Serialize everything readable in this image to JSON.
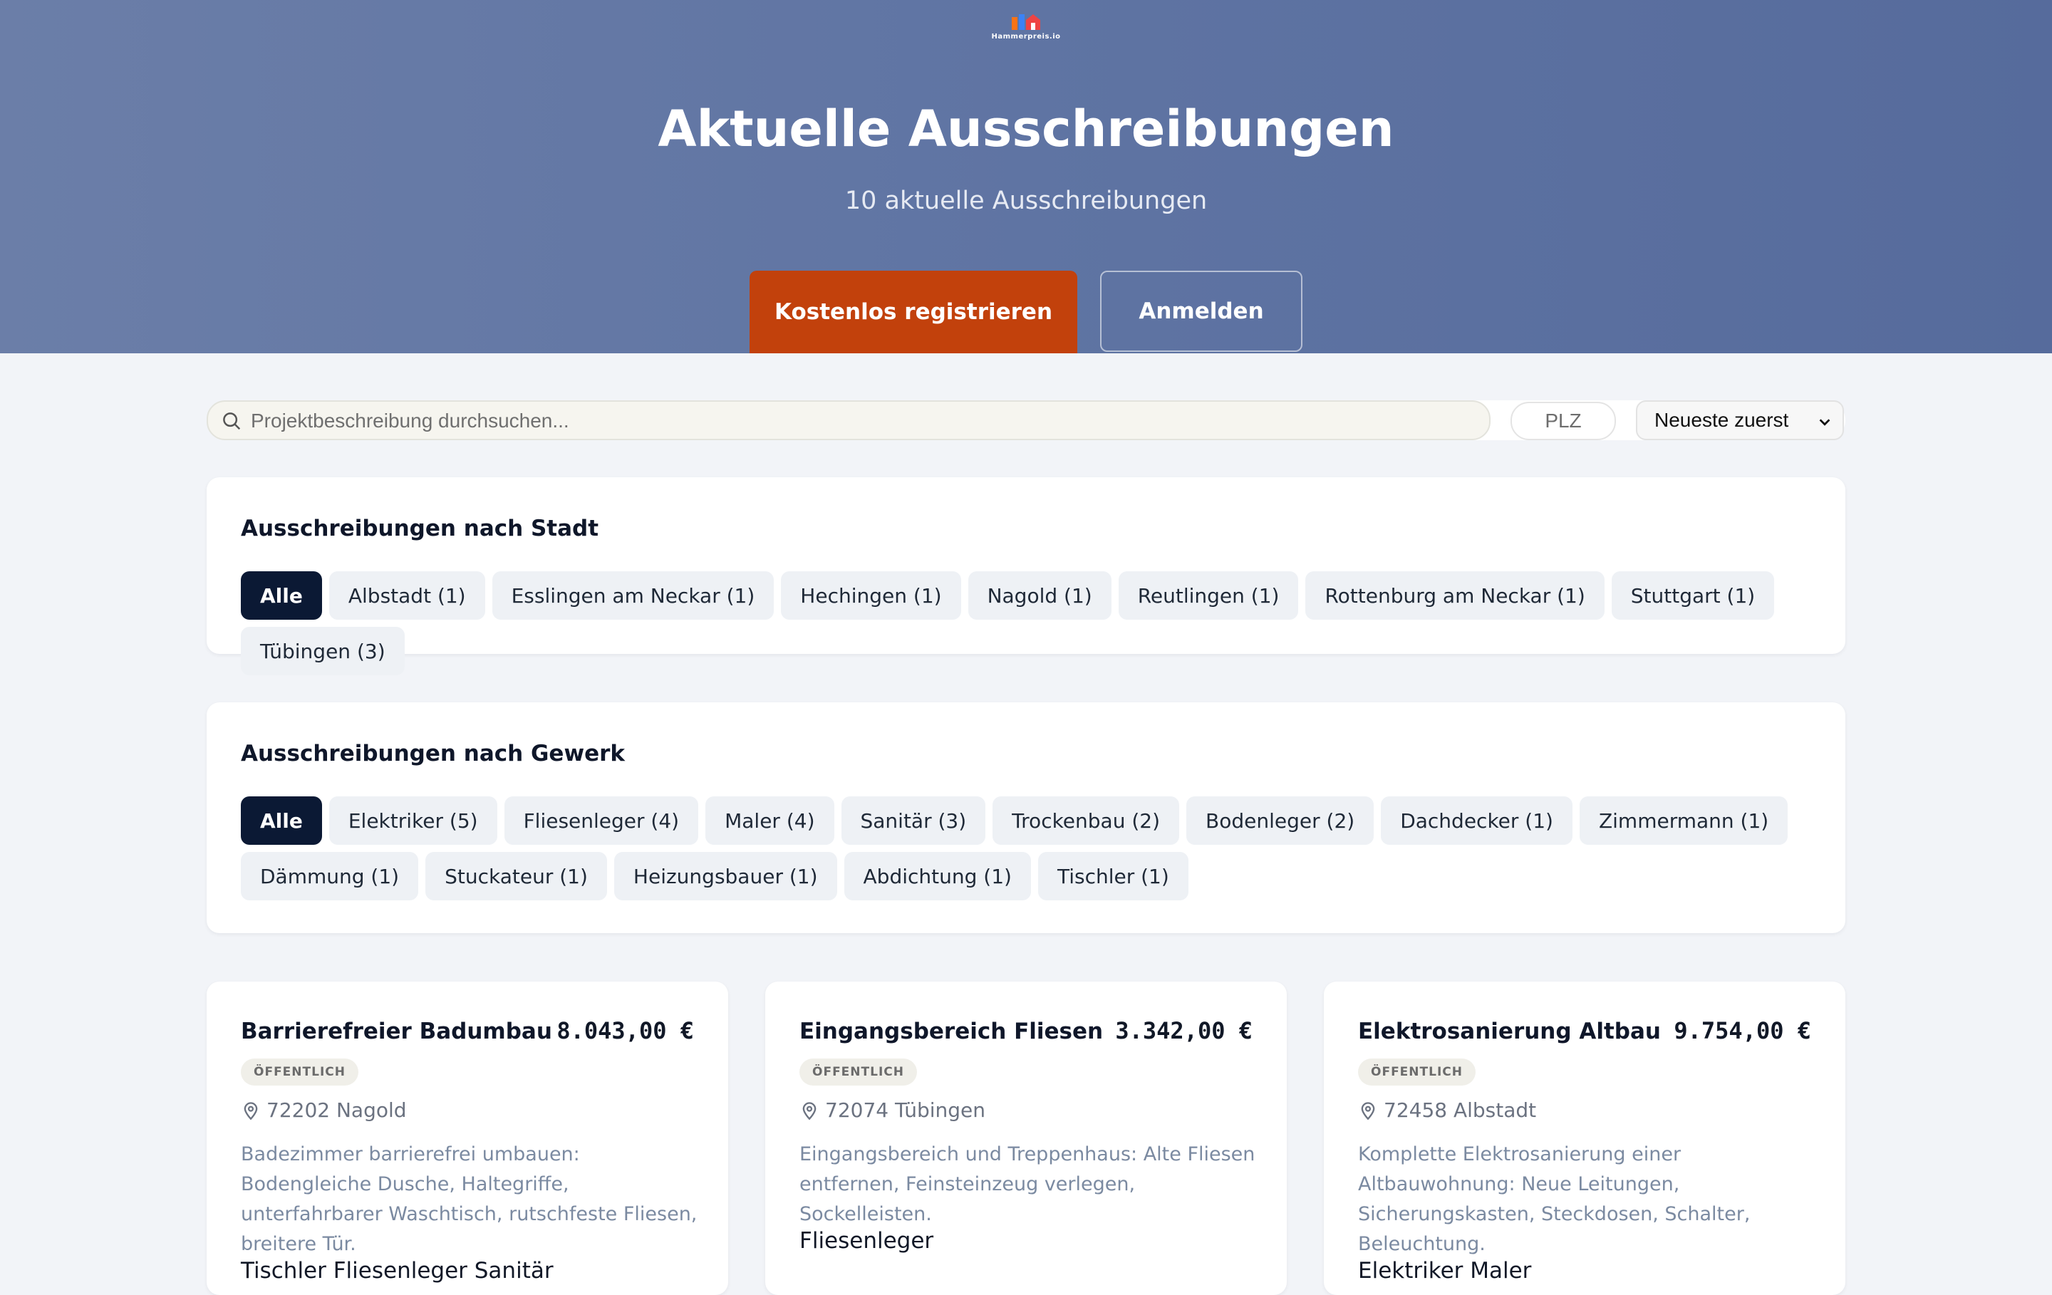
{
  "header": {
    "logo_text": "Hammerpreis.io",
    "title": "Aktuelle Ausschreibungen",
    "subtitle": "10 aktuelle Ausschreibungen",
    "register_label": "Kostenlos registrieren",
    "login_label": "Anmelden"
  },
  "filters": {
    "search_placeholder": "Projektbeschreibung durchsuchen...",
    "plz_placeholder": "PLZ",
    "sort_selected": "Neueste zuerst"
  },
  "cities": {
    "title": "Ausschreibungen nach Stadt",
    "chips": [
      "Alle",
      "Albstadt (1)",
      "Esslingen am Neckar (1)",
      "Hechingen (1)",
      "Nagold (1)",
      "Reutlingen (1)",
      "Rottenburg am Neckar (1)",
      "Stuttgart (1)",
      "Tübingen (3)"
    ]
  },
  "trades": {
    "title": "Ausschreibungen nach Gewerk",
    "chips": [
      "Alle",
      "Elektriker (5)",
      "Fliesenleger (4)",
      "Maler (4)",
      "Sanitär (3)",
      "Trockenbau (2)",
      "Bodenleger (2)",
      "Dachdecker (1)",
      "Zimmermann (1)",
      "Dämmung (1)",
      "Stuckateur (1)",
      "Heizungsbauer (1)",
      "Abdichtung (1)",
      "Tischler (1)"
    ]
  },
  "listings": [
    {
      "title": "Barrierefreier Badumbau",
      "price": "8.043,00 €",
      "badge": "ÖFFENTLICH",
      "location": "72202 Nagold",
      "description": "Badezimmer barrierefrei umbauen: Bodengleiche Dusche, Haltegriffe, unterfahrbarer Waschtisch, rutschfeste Fliesen, breitere Tür.",
      "trades": "Tischler Fliesenleger Sanitär"
    },
    {
      "title": "Eingangsbereich Fliesen",
      "price": "3.342,00 €",
      "badge": "ÖFFENTLICH",
      "location": "72074 Tübingen",
      "description": "Eingangsbereich und Treppenhaus: Alte Fliesen entfernen, Feinsteinzeug verlegen, Sockelleisten.",
      "trades": "Fliesenleger"
    },
    {
      "title": "Elektrosanierung Altbau",
      "price": "9.754,00 €",
      "badge": "ÖFFENTLICH",
      "location": "72458 Albstadt",
      "description": "Komplette Elektrosanierung einer Altbauwohnung: Neue Leitungen, Sicherungskasten, Steckdosen, Schalter, Beleuchtung.",
      "trades": "Elektriker Maler"
    }
  ],
  "colors": {
    "hero": "#6072a1",
    "primary_button": "#c2410c",
    "active_chip": "#0b1934",
    "chip": "#eef1f5"
  }
}
